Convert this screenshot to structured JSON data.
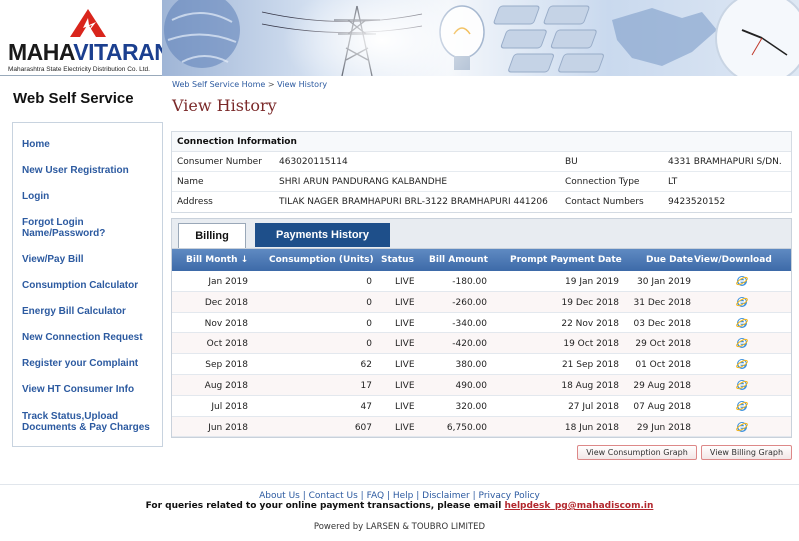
{
  "logo": {
    "brand_a": "MAHA",
    "brand_b": "VITARAN",
    "subtitle": "Maharashtra State Electricity Distribution Co. Ltd."
  },
  "sidebar": {
    "title": "Web Self Service",
    "items": [
      {
        "label": "Home"
      },
      {
        "label": "New User Registration"
      },
      {
        "label": "Login"
      },
      {
        "label": "Forgot Login Name/Password?"
      },
      {
        "label": "View/Pay Bill"
      },
      {
        "label": "Consumption Calculator"
      },
      {
        "label": "Energy Bill Calculator"
      },
      {
        "label": "New Connection Request"
      },
      {
        "label": "Register your Complaint"
      },
      {
        "label": "View HT Consumer Info"
      },
      {
        "label": "Track Status,Upload Documents & Pay Charges"
      }
    ]
  },
  "breadcrumb": {
    "home": "Web Self Service Home",
    "sep": ">",
    "current": "View History"
  },
  "page_title": "View History",
  "connection": {
    "heading": "Connection Information",
    "rows": [
      {
        "l1": "Consumer Number",
        "v1": "463020115114",
        "l2": "BU",
        "v2": "4331 BRAMHAPURI S/DN."
      },
      {
        "l1": "Name",
        "v1": "SHRI ARUN PANDURANG KALBANDHE",
        "l2": "Connection Type",
        "v2": "LT"
      },
      {
        "l1": "Address",
        "v1": "TILAK NAGER BRAMHAPURI BRL-3122 BRAMHAPURI 441206",
        "l2": "Contact Numbers",
        "v2": "9423520152"
      }
    ]
  },
  "tabs": {
    "billing": "Billing",
    "payments": "Payments History"
  },
  "billing_table": {
    "columns": [
      "Bill Month ↓",
      "Consumption (Units)",
      "Status",
      "Bill Amount",
      "Prompt Payment Date",
      "Due Date",
      "View/Download"
    ],
    "rows": [
      {
        "month": "Jan 2019",
        "units": "0",
        "status": "LIVE",
        "amount": "-180.00",
        "prompt": "19 Jan 2019",
        "due": "30 Jan 2019"
      },
      {
        "month": "Dec 2018",
        "units": "0",
        "status": "LIVE",
        "amount": "-260.00",
        "prompt": "19 Dec 2018",
        "due": "31 Dec 2018"
      },
      {
        "month": "Nov 2018",
        "units": "0",
        "status": "LIVE",
        "amount": "-340.00",
        "prompt": "22 Nov 2018",
        "due": "03 Dec 2018"
      },
      {
        "month": "Oct 2018",
        "units": "0",
        "status": "LIVE",
        "amount": "-420.00",
        "prompt": "19 Oct 2018",
        "due": "29 Oct 2018"
      },
      {
        "month": "Sep 2018",
        "units": "62",
        "status": "LIVE",
        "amount": "380.00",
        "prompt": "21 Sep 2018",
        "due": "01 Oct 2018"
      },
      {
        "month": "Aug 2018",
        "units": "17",
        "status": "LIVE",
        "amount": "490.00",
        "prompt": "18 Aug 2018",
        "due": "29 Aug 2018"
      },
      {
        "month": "Jul 2018",
        "units": "47",
        "status": "LIVE",
        "amount": "320.00",
        "prompt": "27 Jul 2018",
        "due": "07 Aug 2018"
      },
      {
        "month": "Jun 2018",
        "units": "607",
        "status": "LIVE",
        "amount": "6,750.00",
        "prompt": "18 Jun 2018",
        "due": "29 Jun 2018"
      }
    ],
    "download_icon": "ie-icon"
  },
  "buttons": {
    "consumption_graph": "View Consumption Graph",
    "billing_graph": "View Billing Graph"
  },
  "footer": {
    "links": [
      "About Us",
      "Contact Us",
      "FAQ",
      "Help",
      "Disclaimer",
      "Privacy Policy"
    ],
    "query_text": "For queries related to your online payment transactions, please email",
    "email": "helpdesk_pg@mahadiscom.in",
    "powered": "Powered by LARSEN & TOUBRO LIMITED"
  },
  "colors": {
    "link": "#2c5aa0",
    "title": "#7b2a2a",
    "tab_active_bg": "#1e4f8a",
    "header_grad": "#4d7ab6",
    "brand_red": "#d9251c"
  }
}
